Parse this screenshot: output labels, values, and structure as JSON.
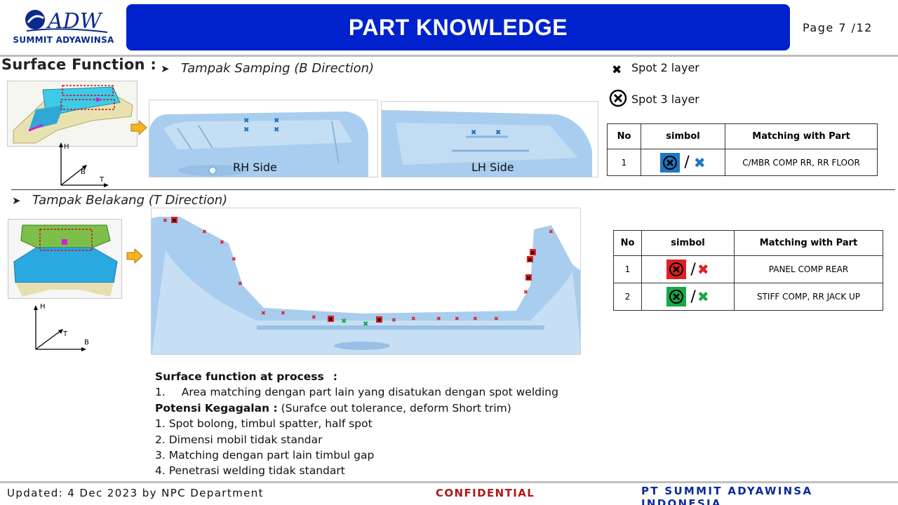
{
  "header": {
    "logo_text": "SUMMIT ADYAWINSA",
    "title": "PART KNOWLEDGE",
    "page_label": "Page  7 /12"
  },
  "section": {
    "title": "Surface  Function :",
    "side_view_title": "Tampak Samping (B Direction)",
    "rear_view_title": "Tampak Belakang (T Direction)"
  },
  "legend": {
    "spot2": "Spot 2 layer",
    "spot3": "Spot 3 layer"
  },
  "photos": {
    "rh_label": "RH Side",
    "lh_label": "LH Side"
  },
  "axes_top": {
    "h": "H",
    "b": "B",
    "t": "T"
  },
  "axes_bottom": {
    "h": "H",
    "t": "T",
    "b": "B"
  },
  "table1": {
    "headers": [
      "No",
      "simbol",
      "Matching with Part"
    ],
    "rows": [
      {
        "no": "1",
        "symbol_color": "#1f77c4",
        "x_color": "#1f77c4",
        "part": "C/MBR COMP RR, RR FLOOR"
      }
    ]
  },
  "table2": {
    "headers": [
      "No",
      "simbol",
      "Matching with Part"
    ],
    "rows": [
      {
        "no": "1",
        "symbol_color": "#e02020",
        "x_color": "#e02020",
        "part": "PANEL COMP REAR"
      },
      {
        "no": "2",
        "symbol_color": "#18a848",
        "x_color": "#18a848",
        "part": "STIFF COMP, RR JACK UP"
      }
    ]
  },
  "notes": {
    "process_title": "Surface function at process",
    "process_colon": ":",
    "process_item_no": "1.",
    "process_item": "Area matching dengan part lain yang disatukan dengan spot welding",
    "failure_title": "Potensi Kegagalan :",
    "failure_desc": " (Surafce out tolerance, deform Short trim)",
    "items": [
      "1. Spot bolong, timbul spatter, half spot",
      "2. Dimensi mobil tidak standar",
      "3. Matching dengan part lain timbul gap",
      "4. Penetrasi welding tidak standart"
    ]
  },
  "footer": {
    "updated": "Updated: 4 Dec 2023 by NPC Department",
    "confidential": "CONFIDENTIAL",
    "company": "PT SUMMIT ADYAWINSA INDONESIA"
  },
  "colors": {
    "title_bar": "#0022cc",
    "confidential": "#b01818",
    "company": "#0a2a9c",
    "part_blue": "#9cc8ec"
  }
}
